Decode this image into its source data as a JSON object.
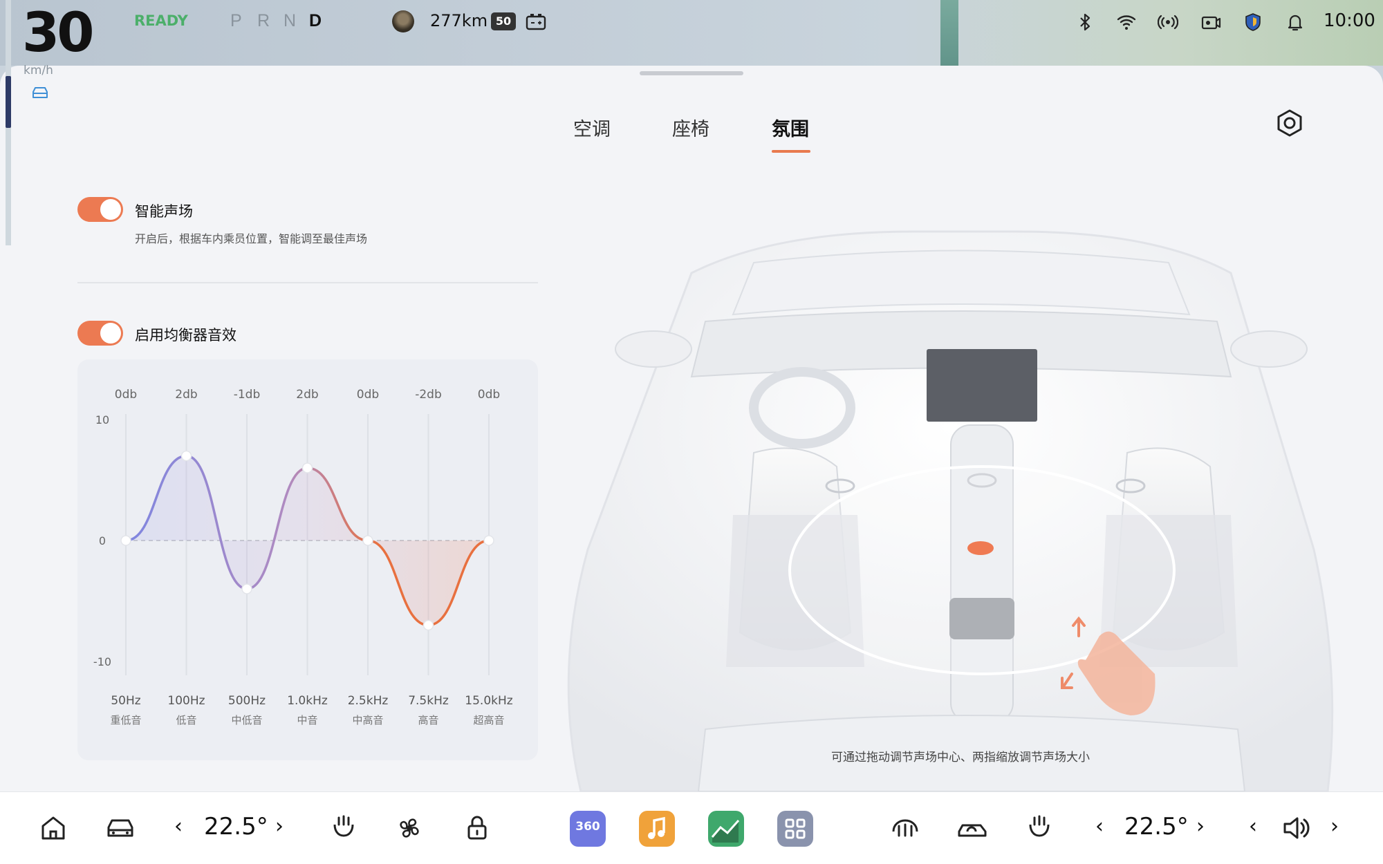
{
  "status_bar": {
    "speed": "30",
    "speed_unit": "km/h",
    "ready_text": "READY",
    "gears": [
      "P",
      "R",
      "N",
      "D"
    ],
    "active_gear": "D",
    "range": "277km",
    "speed_limit": "50",
    "time": "10:00",
    "icons": [
      "bluetooth-icon",
      "wifi-icon",
      "signal-icon",
      "dashcam-icon",
      "shield-icon",
      "bell-icon"
    ]
  },
  "tabs": [
    {
      "label": "空调"
    },
    {
      "label": "座椅"
    },
    {
      "label": "氛围"
    }
  ],
  "active_tab": "氛围",
  "smart_sound": {
    "label": "智能声场",
    "description": "开启后，根据车内乘员位置，智能调至最佳声场",
    "enabled": true
  },
  "equalizer": {
    "label": "启用均衡器音效",
    "enabled": true
  },
  "chart_data": {
    "type": "line",
    "title": "",
    "xlabel": "",
    "ylabel": "",
    "ylim": [
      -10,
      10
    ],
    "y_ticks": [
      "10",
      "0",
      "-10"
    ],
    "categories": [
      "50Hz",
      "100Hz",
      "500Hz",
      "1.0kHz",
      "2.5kHz",
      "7.5kHz",
      "15.0kHz"
    ],
    "category_sublabels": [
      "重低音",
      "低音",
      "中低音",
      "中音",
      "中高音",
      "高音",
      "超高音"
    ],
    "value_labels": [
      "0db",
      "2db",
      "-1db",
      "2db",
      "0db",
      "-2db",
      "0db"
    ],
    "values": [
      0,
      7,
      -4,
      6,
      0,
      -7,
      0
    ],
    "grid": true,
    "colors": {
      "low": "#7f86e0",
      "mid": "#b08ac0",
      "high": "#e8703f"
    }
  },
  "sound_field": {
    "hint": "可通过拖动调节声场中心、两指缩放调节声场大小",
    "center_color": "#ef7a52"
  },
  "dock": {
    "left_temp": "22.5°",
    "right_temp": "22.5°",
    "apps": [
      {
        "name": "360",
        "color": "#6f78e0"
      },
      {
        "name": "music",
        "color": "#f0a23a"
      },
      {
        "name": "stocks",
        "color": "#3fa86c"
      },
      {
        "name": "apps",
        "color": "#8a93ad"
      }
    ]
  }
}
